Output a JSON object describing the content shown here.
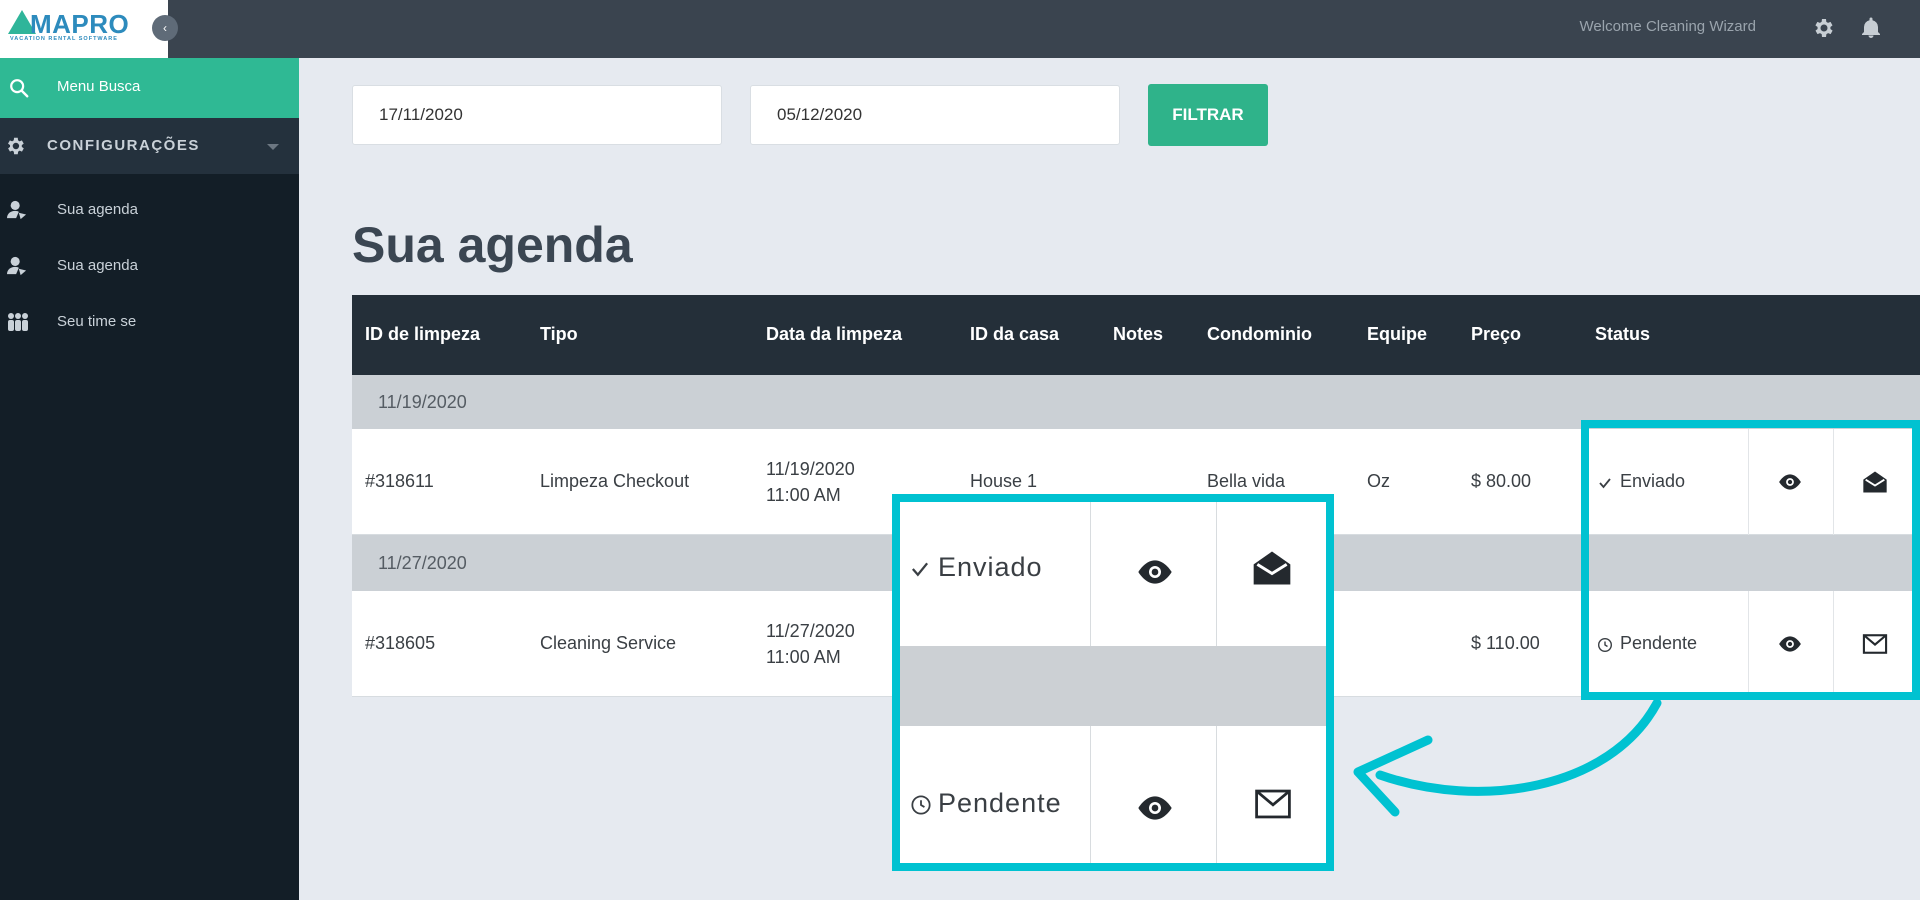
{
  "brand": {
    "logo_text": "MAPRO",
    "logo_subtitle": "VACATION RENTAL SOFTWARE",
    "accent_color": "#2fb994",
    "highlight_color": "#00c2d1"
  },
  "topbar": {
    "welcome": "Welcome Cleaning Wizard",
    "icons": [
      "gear-icon",
      "bell-icon"
    ]
  },
  "sidebar": {
    "items": [
      {
        "label": "Menu Busca",
        "icon": "search-icon",
        "active": true
      },
      {
        "label": "CONFIGURAÇÕES",
        "icon": "gear-icon"
      },
      {
        "label": "Sua agenda",
        "icon": "user-cleaning-icon"
      },
      {
        "label": "Sua agenda",
        "icon": "user-cleaning-icon"
      },
      {
        "label": "Seu time se",
        "icon": "team-icon"
      }
    ]
  },
  "filters": {
    "start_date": "17/11/2020",
    "end_date": "05/12/2020",
    "button_label": "FILTRAR"
  },
  "page": {
    "title": "Sua agenda"
  },
  "table": {
    "columns": [
      "ID de limpeza",
      "Tipo",
      "Data da limpeza",
      "ID da casa",
      "Notes",
      "Condominio",
      "Equipe",
      "Preço",
      "Status"
    ],
    "groups": [
      {
        "date": "11/19/2020",
        "rows": [
          {
            "id": "#318611",
            "tipo": "Limpeza Checkout",
            "data_line1": "11/19/2020",
            "data_line2": "11:00 AM",
            "casa": "House 1",
            "notes": "",
            "condominio": "Bella vida",
            "equipe": "Oz",
            "preco": "$ 80.00",
            "status": "Enviado",
            "status_icon": "check-icon",
            "mail_icon": "mail-open-icon"
          }
        ]
      },
      {
        "date": "11/27/2020",
        "rows": [
          {
            "id": "#318605",
            "tipo": "Cleaning Service",
            "data_line1": "11/27/2020",
            "data_line2": "11:00 AM",
            "casa": "",
            "notes": "",
            "condominio": "",
            "equipe": "",
            "preco": "$ 110.00",
            "status": "Pendente",
            "status_icon": "clock-icon",
            "mail_icon": "mail-closed-icon"
          }
        ]
      }
    ]
  },
  "zoom_callout": {
    "status_sent": "Enviado",
    "status_pending": "Pendente"
  }
}
